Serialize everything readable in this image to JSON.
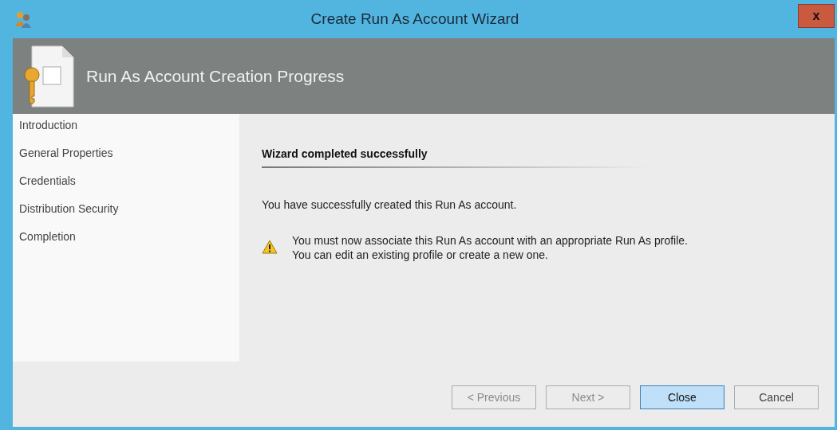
{
  "window": {
    "title": "Create Run As Account Wizard",
    "close_glyph": "x"
  },
  "header": {
    "title": "Run As Account Creation Progress"
  },
  "sidebar": {
    "items": [
      {
        "label": "Introduction"
      },
      {
        "label": "General Properties"
      },
      {
        "label": "Credentials"
      },
      {
        "label": "Distribution Security"
      },
      {
        "label": "Completion"
      }
    ]
  },
  "content": {
    "heading": "Wizard completed successfully",
    "message": "You have successfully created this Run As account.",
    "warning": [
      "You must now associate this Run As account with an appropriate Run As profile.",
      "You can edit an existing profile or create a new one."
    ]
  },
  "buttons": [
    {
      "label": "< Previous",
      "disabled": true,
      "focused": false
    },
    {
      "label": "Next >",
      "disabled": true,
      "focused": false
    },
    {
      "label": "Close",
      "disabled": false,
      "focused": true
    },
    {
      "label": "Cancel",
      "disabled": false,
      "focused": false
    }
  ]
}
